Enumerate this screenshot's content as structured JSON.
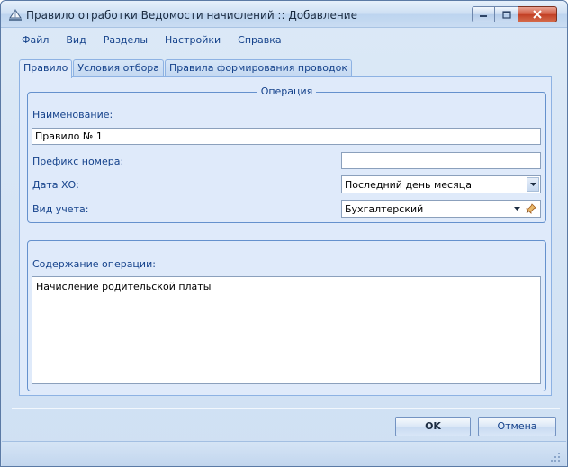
{
  "window": {
    "title": "Правило отработки Ведомости начислений :: Добавление"
  },
  "menu": {
    "items": [
      "Файл",
      "Вид",
      "Разделы",
      "Настройки",
      "Справка"
    ]
  },
  "tabs": [
    {
      "label": "Правило",
      "active": true
    },
    {
      "label": "Условия отбора",
      "active": false
    },
    {
      "label": "Правила формирования проводок",
      "active": false
    }
  ],
  "operation_group": {
    "title": "Операция",
    "name_label": "Наименование:",
    "name_value": "Правило № 1",
    "prefix_label": "Префикс номера:",
    "prefix_value": "",
    "date_label": "Дата ХО:",
    "date_value": "Последний день месяца",
    "accounting_label": "Вид учета:",
    "accounting_value": "Бухгалтерский"
  },
  "content_group": {
    "label": "Содержание операции:",
    "value": "Начисление родительской платы"
  },
  "buttons": {
    "ok": "OK",
    "cancel": "Отмена"
  },
  "colors": {
    "accent": "#15428b",
    "panel": "#dfeafa",
    "border": "#6591cd"
  }
}
